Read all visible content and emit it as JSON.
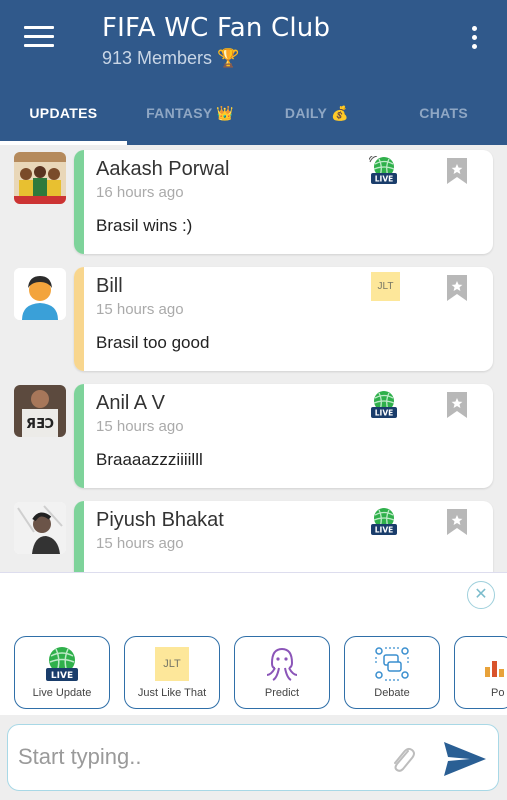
{
  "header": {
    "title": "FIFA WC Fan Club",
    "subtitle": "913 Members 🏆",
    "bg_color": "#30598b"
  },
  "tabs": [
    {
      "label": "UPDATES",
      "active": true
    },
    {
      "label": "FANTASY 👑",
      "active": false
    },
    {
      "label": "DAILY 💰",
      "active": false
    },
    {
      "label": "CHATS",
      "active": false
    }
  ],
  "posts": [
    {
      "author": "Aakash Porwal",
      "time": "16 hours ago",
      "message": "Brasil wins :)",
      "badge": "live",
      "accent": "#7ed39a"
    },
    {
      "author": "Bill",
      "time": "15 hours ago",
      "message": "Brasil too good",
      "badge": "jlt",
      "badge_text": "JLT",
      "accent": "#f8d68e"
    },
    {
      "author": "Anil A V",
      "time": "15 hours ago",
      "message": "Braaaazzziiiilll",
      "badge": "live",
      "accent": "#7ed39a"
    },
    {
      "author": "Piyush Bhakat",
      "time": "15 hours ago",
      "message": "",
      "badge": "live",
      "accent": "#7ed39a"
    }
  ],
  "live_badge_text": "LIVE",
  "actions": [
    {
      "label": "Live Update",
      "icon": "live-icon"
    },
    {
      "label": "Just Like That",
      "icon": "jlt-icon",
      "icon_text": "JLT"
    },
    {
      "label": "Predict",
      "icon": "octopus-icon"
    },
    {
      "label": "Debate",
      "icon": "debate-icon"
    },
    {
      "label": "Po",
      "icon": "poll-icon"
    }
  ],
  "compose": {
    "placeholder": "Start typing.."
  },
  "colors": {
    "accent_blue": "#30598b",
    "green_bar": "#7ed39a",
    "yellow_bar": "#f8d68e",
    "send_blue": "#2a5f94"
  }
}
